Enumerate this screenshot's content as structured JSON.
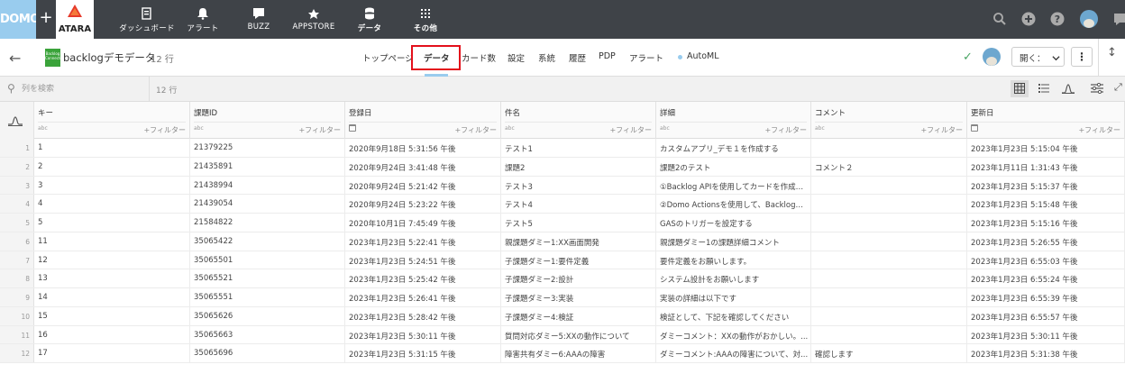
{
  "topbar": {
    "logo_text": "DOMO",
    "plus": "+",
    "brand_name": "ATARA",
    "nav": [
      {
        "label": "ダッシュボード",
        "icon": "dashboard-icon"
      },
      {
        "label": "アラート",
        "icon": "bell-icon"
      },
      {
        "label": "BUZZ",
        "icon": "chat-icon"
      },
      {
        "label": "APPSTORE",
        "icon": "appstore-icon"
      },
      {
        "label": "データ",
        "icon": "database-icon"
      },
      {
        "label": "その他",
        "icon": "grid-icon"
      }
    ]
  },
  "dataset": {
    "icon_text": "Backlog Connector",
    "title": "backlogデモデータ",
    "row_count": "12 行"
  },
  "tabs": [
    "トップページ",
    "データ",
    "カード数",
    "設定",
    "系統",
    "履歴",
    "PDP",
    "アラート",
    "AutoML"
  ],
  "actions": {
    "open_label": "開く：",
    "kebab": "⋮"
  },
  "search": {
    "placeholder": "列を検索",
    "count": "12 行"
  },
  "filter_label": "+フィルター",
  "columns": [
    {
      "name": "キー",
      "type": "abc"
    },
    {
      "name": "課題ID",
      "type": "abc"
    },
    {
      "name": "登録日",
      "type": "date"
    },
    {
      "name": "件名",
      "type": "abc"
    },
    {
      "name": "詳細",
      "type": "abc"
    },
    {
      "name": "コメント",
      "type": "abc"
    },
    {
      "name": "更新日",
      "type": "date"
    }
  ],
  "rows": [
    [
      "1",
      "21379225",
      "2020年9月18日 5:31:56 午後",
      "テスト1",
      "カスタムアプリ_デモ１を作成する",
      "",
      "2023年1月23日 5:15:04 午後"
    ],
    [
      "2",
      "21435891",
      "2020年9月24日 3:41:48 午後",
      "課題2",
      "課題2のテスト",
      "コメント２",
      "2023年1月11日 1:31:43 午後"
    ],
    [
      "3",
      "21438994",
      "2020年9月24日 5:21:42 午後",
      "テスト3",
      "①Backlog APIを使用してカードを作成（...",
      "",
      "2023年1月23日 5:15:37 午後"
    ],
    [
      "4",
      "21439054",
      "2020年9月24日 5:23:22 午後",
      "テスト4",
      "②Domo Actionsを使用して、Backlogの...",
      "",
      "2023年1月23日 5:15:48 午後"
    ],
    [
      "5",
      "21584822",
      "2020年10月1日 7:45:49 午後",
      "テスト5",
      "GASのトリガーを設定する",
      "",
      "2023年1月23日 5:15:16 午後"
    ],
    [
      "11",
      "35065422",
      "2023年1月23日 5:22:41 午後",
      "親課題ダミー1:XX画面開発",
      "親課題ダミー1の課題詳細コメント",
      "",
      "2023年1月23日 5:26:55 午後"
    ],
    [
      "12",
      "35065501",
      "2023年1月23日 5:24:51 午後",
      "子課題ダミー1:要件定義",
      "要件定義をお願いします。",
      "",
      "2023年1月23日 6:55:03 午後"
    ],
    [
      "13",
      "35065521",
      "2023年1月23日 5:25:42 午後",
      "子課題ダミー2:設計",
      "システム設計をお願いします",
      "",
      "2023年1月23日 6:55:24 午後"
    ],
    [
      "14",
      "35065551",
      "2023年1月23日 5:26:41 午後",
      "子課題ダミー3:実装",
      "実装の詳細は以下です",
      "",
      "2023年1月23日 6:55:39 午後"
    ],
    [
      "15",
      "35065626",
      "2023年1月23日 5:28:42 午後",
      "子課題ダミー4:検証",
      "検証として、下記を確認してください",
      "",
      "2023年1月23日 6:55:57 午後"
    ],
    [
      "16",
      "35065663",
      "2023年1月23日 5:30:11 午後",
      "質問対応ダミー5:XXの動作について",
      "ダミーコメント：XXの動作がおかしい。...",
      "",
      "2023年1月23日 5:30:11 午後"
    ],
    [
      "17",
      "35065696",
      "2023年1月23日 5:31:15 午後",
      "障害共有ダミー6:AAAの障害",
      "ダミーコメント:AAAの障害について、対...",
      "確認します",
      "2023年1月23日 5:31:38 午後"
    ]
  ],
  "colors": {
    "topbar": "#3f4348",
    "domo_logo": "#99ccee",
    "highlight": "#e3101b",
    "accent": "#99ccee"
  }
}
